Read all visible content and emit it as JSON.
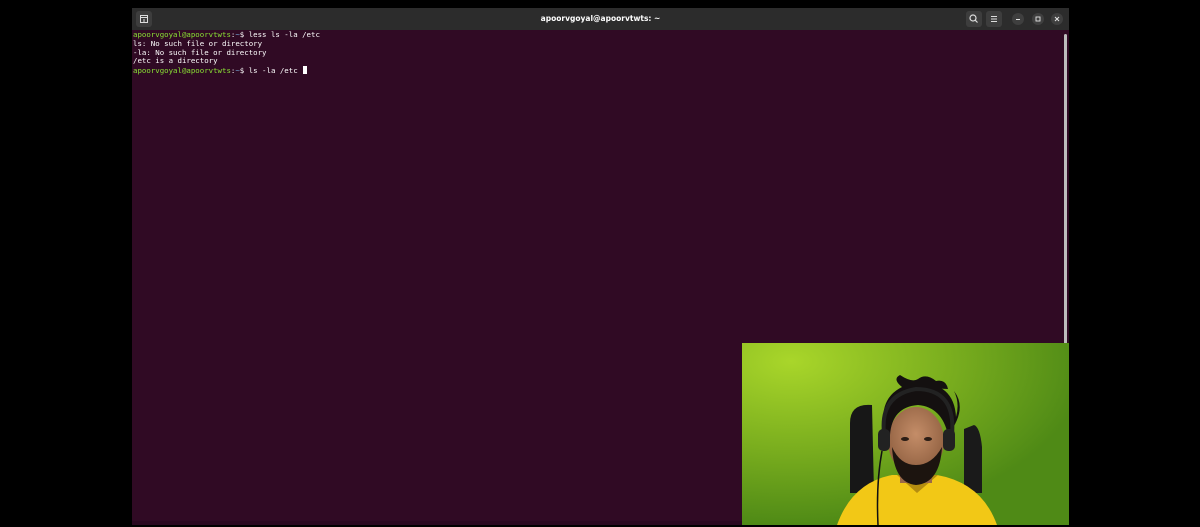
{
  "window": {
    "title": "apoorvgoyal@apoorvtwts: ~",
    "buttons": {
      "new_tab_icon": "new-tab-icon",
      "search_icon": "search-icon",
      "menu_icon": "hamburger-menu-icon",
      "minimize_icon": "minimize-icon",
      "maximize_icon": "maximize-icon",
      "close_icon": "close-icon"
    }
  },
  "terminal": {
    "prompt": {
      "user_host": "apoorvgoyal@apoorvtwts",
      "separator": ":",
      "path": "~",
      "symbol": "$"
    },
    "lines": [
      {
        "type": "command",
        "text": " less ls -la /etc"
      },
      {
        "type": "output",
        "text": "ls: No such file or directory"
      },
      {
        "type": "output",
        "text": "-la: No such file or directory"
      },
      {
        "type": "output",
        "text": "/etc is a directory"
      },
      {
        "type": "command",
        "text": " ls -la /etc "
      }
    ]
  },
  "colors": {
    "terminal_background": "#300a24",
    "prompt_user": "#8ae234",
    "prompt_path": "#729fcf",
    "titlebar": "#2c2c2c",
    "webcam_background": "#6fa31f"
  },
  "webcam": {
    "content": "presenter-webcam-overlay"
  }
}
